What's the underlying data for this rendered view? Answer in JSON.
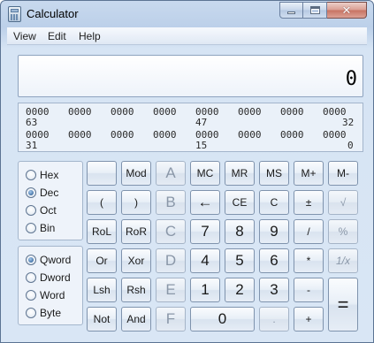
{
  "window": {
    "title": "Calculator"
  },
  "menu": {
    "items": [
      "View",
      "Edit",
      "Help"
    ]
  },
  "display": {
    "value": "0"
  },
  "bits": {
    "row1": [
      "0000",
      "0000",
      "0000",
      "0000",
      "0000",
      "0000",
      "0000",
      "0000"
    ],
    "row1_labels": [
      "63",
      "47",
      "32"
    ],
    "row2": [
      "0000",
      "0000",
      "0000",
      "0000",
      "0000",
      "0000",
      "0000",
      "0000"
    ],
    "row2_labels": [
      "31",
      "15",
      "0"
    ]
  },
  "base": {
    "options": [
      "Hex",
      "Dec",
      "Oct",
      "Bin"
    ],
    "selected": "Dec"
  },
  "word_size": {
    "options": [
      "Qword",
      "Dword",
      "Word",
      "Byte"
    ],
    "selected": "Qword"
  },
  "keys": {
    "r1": [
      "",
      "Mod",
      "A",
      "MC",
      "MR",
      "MS",
      "M+",
      "M-"
    ],
    "r2": [
      "(",
      ")",
      "B",
      "←",
      "CE",
      "C",
      "±",
      "√"
    ],
    "r3": [
      "RoL",
      "RoR",
      "C",
      "7",
      "8",
      "9",
      "/",
      "%"
    ],
    "r4": [
      "Or",
      "Xor",
      "D",
      "4",
      "5",
      "6",
      "*",
      "1/x"
    ],
    "r5": [
      "Lsh",
      "Rsh",
      "E",
      "1",
      "2",
      "3",
      "-",
      "="
    ],
    "r6": [
      "Not",
      "And",
      "F",
      "0",
      ".",
      "+"
    ]
  },
  "colors": {
    "titlebar": "#bcd0e9",
    "face": "#d9e6f5",
    "key_border": "#7f93ad",
    "close": "#c77262"
  }
}
